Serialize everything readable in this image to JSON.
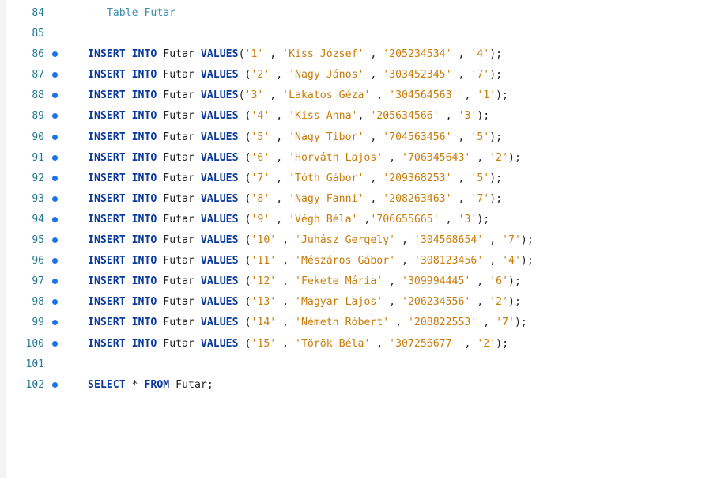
{
  "editor": {
    "lines": [
      {
        "num": "84",
        "marker": false,
        "tokens": [
          {
            "t": "cm",
            "v": "-- Table Futar"
          }
        ]
      },
      {
        "num": "85",
        "marker": false,
        "tokens": []
      },
      {
        "num": "86",
        "marker": true,
        "tokens": [
          {
            "t": "kw",
            "v": "INSERT INTO"
          },
          {
            "t": "id",
            "v": " Futar "
          },
          {
            "t": "kw",
            "v": "VALUES"
          },
          {
            "t": "pun",
            "v": "("
          },
          {
            "t": "str",
            "v": "'1'"
          },
          {
            "t": "pun",
            "v": " , "
          },
          {
            "t": "str",
            "v": "'Kiss József'"
          },
          {
            "t": "pun",
            "v": " , "
          },
          {
            "t": "str",
            "v": "'205234534'"
          },
          {
            "t": "pun",
            "v": " , "
          },
          {
            "t": "str",
            "v": "'4'"
          },
          {
            "t": "pun",
            "v": ");"
          }
        ]
      },
      {
        "num": "87",
        "marker": true,
        "tokens": [
          {
            "t": "kw",
            "v": "INSERT INTO"
          },
          {
            "t": "id",
            "v": " Futar "
          },
          {
            "t": "kw",
            "v": "VALUES"
          },
          {
            "t": "pun",
            "v": " ("
          },
          {
            "t": "str",
            "v": "'2'"
          },
          {
            "t": "pun",
            "v": " , "
          },
          {
            "t": "str",
            "v": "'Nagy János'"
          },
          {
            "t": "pun",
            "v": " , "
          },
          {
            "t": "str",
            "v": "'303452345'"
          },
          {
            "t": "pun",
            "v": " , "
          },
          {
            "t": "str",
            "v": "'7'"
          },
          {
            "t": "pun",
            "v": ");"
          }
        ]
      },
      {
        "num": "88",
        "marker": true,
        "tokens": [
          {
            "t": "kw",
            "v": "INSERT INTO"
          },
          {
            "t": "id",
            "v": " Futar "
          },
          {
            "t": "kw",
            "v": "VALUES"
          },
          {
            "t": "pun",
            "v": "("
          },
          {
            "t": "str",
            "v": "'3'"
          },
          {
            "t": "pun",
            "v": " , "
          },
          {
            "t": "str",
            "v": "'Lakatos Géza'"
          },
          {
            "t": "pun",
            "v": " , "
          },
          {
            "t": "str",
            "v": "'304564563'"
          },
          {
            "t": "pun",
            "v": " , "
          },
          {
            "t": "str",
            "v": "'1'"
          },
          {
            "t": "pun",
            "v": ");"
          }
        ]
      },
      {
        "num": "89",
        "marker": true,
        "tokens": [
          {
            "t": "kw",
            "v": "INSERT INTO"
          },
          {
            "t": "id",
            "v": " Futar "
          },
          {
            "t": "kw",
            "v": "VALUES"
          },
          {
            "t": "pun",
            "v": " ("
          },
          {
            "t": "str",
            "v": "'4'"
          },
          {
            "t": "pun",
            "v": " , "
          },
          {
            "t": "str",
            "v": "'Kiss Anna'"
          },
          {
            "t": "pun",
            "v": ", "
          },
          {
            "t": "str",
            "v": "'205634566'"
          },
          {
            "t": "pun",
            "v": " , "
          },
          {
            "t": "str",
            "v": "'3'"
          },
          {
            "t": "pun",
            "v": ");"
          }
        ]
      },
      {
        "num": "90",
        "marker": true,
        "tokens": [
          {
            "t": "kw",
            "v": "INSERT INTO"
          },
          {
            "t": "id",
            "v": " Futar "
          },
          {
            "t": "kw",
            "v": "VALUES"
          },
          {
            "t": "pun",
            "v": " ("
          },
          {
            "t": "str",
            "v": "'5'"
          },
          {
            "t": "pun",
            "v": " , "
          },
          {
            "t": "str",
            "v": "'Nagy Tibor'"
          },
          {
            "t": "pun",
            "v": " , "
          },
          {
            "t": "str",
            "v": "'704563456'"
          },
          {
            "t": "pun",
            "v": " , "
          },
          {
            "t": "str",
            "v": "'5'"
          },
          {
            "t": "pun",
            "v": ");"
          }
        ]
      },
      {
        "num": "91",
        "marker": true,
        "tokens": [
          {
            "t": "kw",
            "v": "INSERT INTO"
          },
          {
            "t": "id",
            "v": " Futar "
          },
          {
            "t": "kw",
            "v": "VALUES"
          },
          {
            "t": "pun",
            "v": " ("
          },
          {
            "t": "str",
            "v": "'6'"
          },
          {
            "t": "pun",
            "v": " , "
          },
          {
            "t": "str",
            "v": "'Horváth Lajos'"
          },
          {
            "t": "pun",
            "v": " , "
          },
          {
            "t": "str",
            "v": "'706345643'"
          },
          {
            "t": "pun",
            "v": " , "
          },
          {
            "t": "str",
            "v": "'2'"
          },
          {
            "t": "pun",
            "v": ");"
          }
        ]
      },
      {
        "num": "92",
        "marker": true,
        "tokens": [
          {
            "t": "kw",
            "v": "INSERT INTO"
          },
          {
            "t": "id",
            "v": " Futar "
          },
          {
            "t": "kw",
            "v": "VALUES"
          },
          {
            "t": "pun",
            "v": " ("
          },
          {
            "t": "str",
            "v": "'7'"
          },
          {
            "t": "pun",
            "v": " , "
          },
          {
            "t": "str",
            "v": "'Tóth Gábor'"
          },
          {
            "t": "pun",
            "v": " , "
          },
          {
            "t": "str",
            "v": "'209368253'"
          },
          {
            "t": "pun",
            "v": " , "
          },
          {
            "t": "str",
            "v": "'5'"
          },
          {
            "t": "pun",
            "v": ");"
          }
        ]
      },
      {
        "num": "93",
        "marker": true,
        "tokens": [
          {
            "t": "kw",
            "v": "INSERT INTO"
          },
          {
            "t": "id",
            "v": " Futar "
          },
          {
            "t": "kw",
            "v": "VALUES"
          },
          {
            "t": "pun",
            "v": " ("
          },
          {
            "t": "str",
            "v": "'8'"
          },
          {
            "t": "pun",
            "v": " , "
          },
          {
            "t": "str",
            "v": "'Nagy Fanni'"
          },
          {
            "t": "pun",
            "v": " , "
          },
          {
            "t": "str",
            "v": "'208263463'"
          },
          {
            "t": "pun",
            "v": " , "
          },
          {
            "t": "str",
            "v": "'7'"
          },
          {
            "t": "pun",
            "v": ");"
          }
        ]
      },
      {
        "num": "94",
        "marker": true,
        "tokens": [
          {
            "t": "kw",
            "v": "INSERT INTO"
          },
          {
            "t": "id",
            "v": " Futar "
          },
          {
            "t": "kw",
            "v": "VALUES"
          },
          {
            "t": "pun",
            "v": " ("
          },
          {
            "t": "str",
            "v": "'9'"
          },
          {
            "t": "pun",
            "v": " , "
          },
          {
            "t": "str",
            "v": "'Végh Béla'"
          },
          {
            "t": "pun",
            "v": " ,"
          },
          {
            "t": "str",
            "v": "'706655665'"
          },
          {
            "t": "pun",
            "v": " , "
          },
          {
            "t": "str",
            "v": "'3'"
          },
          {
            "t": "pun",
            "v": ");"
          }
        ]
      },
      {
        "num": "95",
        "marker": true,
        "tokens": [
          {
            "t": "kw",
            "v": "INSERT INTO"
          },
          {
            "t": "id",
            "v": " Futar "
          },
          {
            "t": "kw",
            "v": "VALUES"
          },
          {
            "t": "pun",
            "v": " ("
          },
          {
            "t": "str",
            "v": "'10'"
          },
          {
            "t": "pun",
            "v": " , "
          },
          {
            "t": "str",
            "v": "'Juhász Gergely'"
          },
          {
            "t": "pun",
            "v": " , "
          },
          {
            "t": "str",
            "v": "'304568654'"
          },
          {
            "t": "pun",
            "v": " , "
          },
          {
            "t": "str",
            "v": "'7'"
          },
          {
            "t": "pun",
            "v": ");"
          }
        ]
      },
      {
        "num": "96",
        "marker": true,
        "tokens": [
          {
            "t": "kw",
            "v": "INSERT INTO"
          },
          {
            "t": "id",
            "v": " Futar "
          },
          {
            "t": "kw",
            "v": "VALUES"
          },
          {
            "t": "pun",
            "v": " ("
          },
          {
            "t": "str",
            "v": "'11'"
          },
          {
            "t": "pun",
            "v": " , "
          },
          {
            "t": "str",
            "v": "'Mészáros Gábor'"
          },
          {
            "t": "pun",
            "v": " , "
          },
          {
            "t": "str",
            "v": "'308123456'"
          },
          {
            "t": "pun",
            "v": " , "
          },
          {
            "t": "str",
            "v": "'4'"
          },
          {
            "t": "pun",
            "v": ");"
          }
        ]
      },
      {
        "num": "97",
        "marker": true,
        "tokens": [
          {
            "t": "kw",
            "v": "INSERT INTO"
          },
          {
            "t": "id",
            "v": " Futar "
          },
          {
            "t": "kw",
            "v": "VALUES"
          },
          {
            "t": "pun",
            "v": " ("
          },
          {
            "t": "str",
            "v": "'12'"
          },
          {
            "t": "pun",
            "v": " , "
          },
          {
            "t": "str",
            "v": "'Fekete Mária'"
          },
          {
            "t": "pun",
            "v": " , "
          },
          {
            "t": "str",
            "v": "'309994445'"
          },
          {
            "t": "pun",
            "v": " , "
          },
          {
            "t": "str",
            "v": "'6'"
          },
          {
            "t": "pun",
            "v": ");"
          }
        ]
      },
      {
        "num": "98",
        "marker": true,
        "tokens": [
          {
            "t": "kw",
            "v": "INSERT INTO"
          },
          {
            "t": "id",
            "v": " Futar "
          },
          {
            "t": "kw",
            "v": "VALUES"
          },
          {
            "t": "pun",
            "v": " ("
          },
          {
            "t": "str",
            "v": "'13'"
          },
          {
            "t": "pun",
            "v": " , "
          },
          {
            "t": "str",
            "v": "'Magyar Lajos'"
          },
          {
            "t": "pun",
            "v": " , "
          },
          {
            "t": "str",
            "v": "'206234556'"
          },
          {
            "t": "pun",
            "v": " , "
          },
          {
            "t": "str",
            "v": "'2'"
          },
          {
            "t": "pun",
            "v": ");"
          }
        ]
      },
      {
        "num": "99",
        "marker": true,
        "tokens": [
          {
            "t": "kw",
            "v": "INSERT INTO"
          },
          {
            "t": "id",
            "v": " Futar "
          },
          {
            "t": "kw",
            "v": "VALUES"
          },
          {
            "t": "pun",
            "v": " ("
          },
          {
            "t": "str",
            "v": "'14'"
          },
          {
            "t": "pun",
            "v": " , "
          },
          {
            "t": "str",
            "v": "'Németh Róbert'"
          },
          {
            "t": "pun",
            "v": " , "
          },
          {
            "t": "str",
            "v": "'208822553'"
          },
          {
            "t": "pun",
            "v": " , "
          },
          {
            "t": "str",
            "v": "'7'"
          },
          {
            "t": "pun",
            "v": ");"
          }
        ]
      },
      {
        "num": "100",
        "marker": true,
        "tokens": [
          {
            "t": "kw",
            "v": "INSERT INTO"
          },
          {
            "t": "id",
            "v": " Futar "
          },
          {
            "t": "kw",
            "v": "VALUES"
          },
          {
            "t": "pun",
            "v": " ("
          },
          {
            "t": "str",
            "v": "'15'"
          },
          {
            "t": "pun",
            "v": " , "
          },
          {
            "t": "str",
            "v": "'Török Béla'"
          },
          {
            "t": "pun",
            "v": " , "
          },
          {
            "t": "str",
            "v": "'307256677'"
          },
          {
            "t": "pun",
            "v": " , "
          },
          {
            "t": "str",
            "v": "'2'"
          },
          {
            "t": "pun",
            "v": ");"
          }
        ]
      },
      {
        "num": "101",
        "marker": false,
        "tokens": []
      },
      {
        "num": "102",
        "marker": true,
        "tokens": [
          {
            "t": "kw",
            "v": "SELECT"
          },
          {
            "t": "id",
            "v": " * "
          },
          {
            "t": "kw",
            "v": "FROM"
          },
          {
            "t": "id",
            "v": " Futar;"
          }
        ]
      }
    ]
  },
  "colors": {
    "keyword": "#0b3a9b",
    "string": "#c97c0a",
    "comment": "#3b8bb0",
    "line_number": "#237893",
    "marker_dot": "#1a73e8",
    "background": "#ffffff"
  }
}
